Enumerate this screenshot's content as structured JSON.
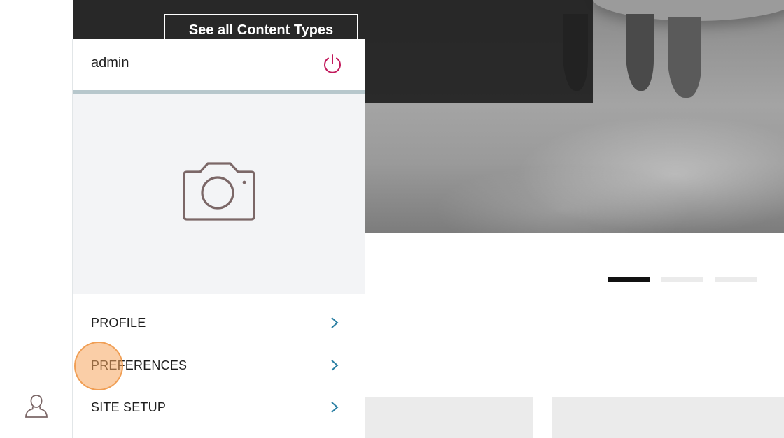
{
  "hero": {
    "cta_label": "See all Content Types"
  },
  "carousel": {
    "slides": 3,
    "active_index": 0
  },
  "user_panel": {
    "username": "admin",
    "logout_icon": "power-icon",
    "photo_icon": "camera-icon",
    "menu": [
      {
        "label": "PROFILE",
        "icon": "chevron-right-icon"
      },
      {
        "label": "PREFERENCES",
        "icon": "chevron-right-icon"
      },
      {
        "label": "SITE SETUP",
        "icon": "chevron-right-icon"
      }
    ]
  },
  "left_rail": {
    "user_icon": "user-icon"
  },
  "colors": {
    "logout_icon": "#c2185b",
    "chevron": "#2a7fa3",
    "menu_divider": "#8fb3b8",
    "header_divider": "#b7c7cc",
    "photo_background": "#f3f4f6",
    "camera_icon": "#7b6767",
    "click_highlight": "#f5a65e"
  }
}
